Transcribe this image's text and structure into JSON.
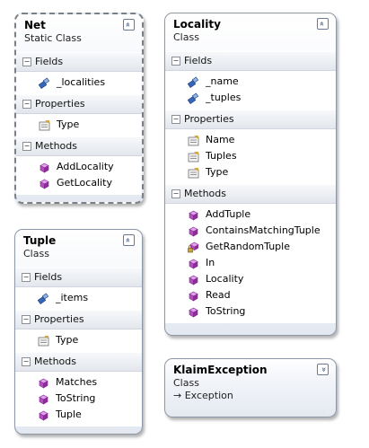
{
  "classes": {
    "net": {
      "name": "Net",
      "stereotype": "Static Class",
      "toggle": "»",
      "fields_label": "Fields",
      "fields": [
        "_localities"
      ],
      "properties_label": "Properties",
      "properties": [
        "Type"
      ],
      "methods_label": "Methods",
      "methods": [
        "AddLocality",
        "GetLocality"
      ]
    },
    "locality": {
      "name": "Locality",
      "stereotype": "Class",
      "toggle": "»",
      "fields_label": "Fields",
      "fields": [
        "_name",
        "_tuples"
      ],
      "properties_label": "Properties",
      "properties": [
        "Name",
        "Tuples",
        "Type"
      ],
      "methods_label": "Methods",
      "methods": [
        "AddTuple",
        "ContainsMatchingTuple",
        "GetRandomTuple",
        "In",
        "Locality",
        "Read",
        "ToString"
      ]
    },
    "tuple": {
      "name": "Tuple",
      "stereotype": "Class",
      "toggle": "»",
      "fields_label": "Fields",
      "fields": [
        "_items"
      ],
      "properties_label": "Properties",
      "properties": [
        "Type"
      ],
      "methods_label": "Methods",
      "methods": [
        "Matches",
        "ToString",
        "Tuple"
      ]
    },
    "klaim_exception": {
      "name": "KlaimException",
      "stereotype": "Class",
      "toggle": "»",
      "base_class": "→ Exception"
    }
  },
  "section_toggle": "−",
  "icons": {
    "field": "field-icon",
    "property": "property-icon",
    "method": "method-icon",
    "private_method": "private-method-icon"
  },
  "colors": {
    "border": "#8e97a6",
    "header_gradient_end": "#e4e9f1",
    "method_icon": "#b44fc0",
    "field_icon": "#3566b8"
  }
}
